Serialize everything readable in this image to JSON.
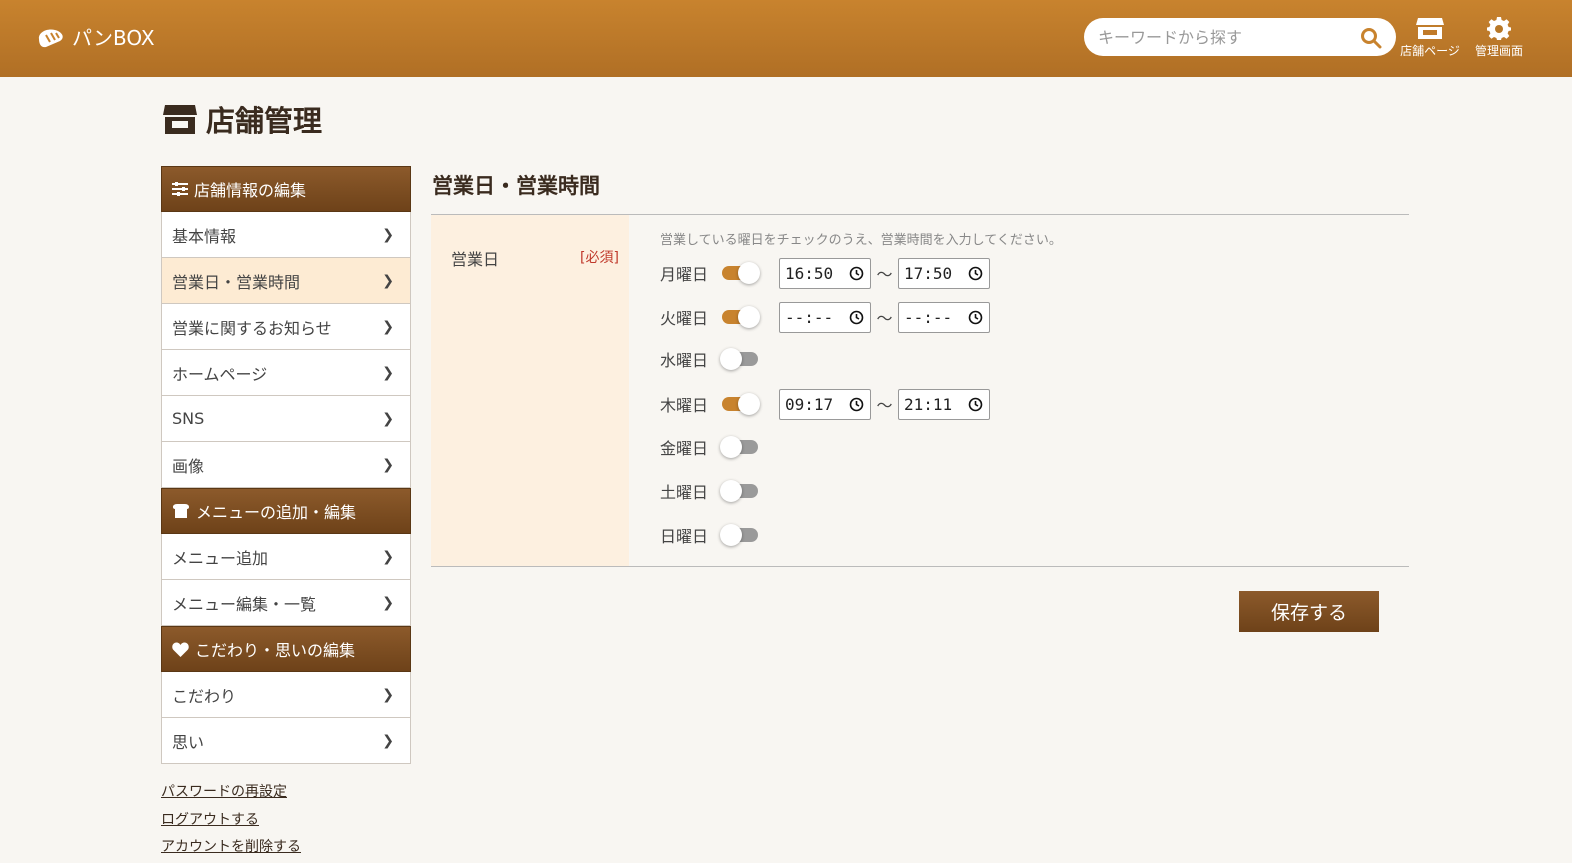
{
  "header": {
    "logo_text": "パンBOX",
    "search_placeholder": "キーワードから探す",
    "store_page_label": "店舗ページ",
    "admin_label": "管理画面"
  },
  "page_title": "店舗管理",
  "sidebar": {
    "sections": [
      {
        "title": "店舗情報の編集",
        "icon": "sliders-icon",
        "items": [
          {
            "label": "基本情報",
            "active": false
          },
          {
            "label": "営業日・営業時間",
            "active": true
          },
          {
            "label": "営業に関するお知らせ",
            "active": false
          },
          {
            "label": "ホームページ",
            "active": false
          },
          {
            "label": "SNS",
            "active": false
          },
          {
            "label": "画像",
            "active": false
          }
        ]
      },
      {
        "title": "メニューの追加・編集",
        "icon": "bread-icon",
        "items": [
          {
            "label": "メニュー追加",
            "active": false
          },
          {
            "label": "メニュー編集・一覧",
            "active": false
          }
        ]
      },
      {
        "title": "こだわり・思いの編集",
        "icon": "heart-icon",
        "items": [
          {
            "label": "こだわり",
            "active": false
          },
          {
            "label": "思い",
            "active": false
          }
        ]
      }
    ],
    "links": [
      "パスワードの再設定",
      "ログアウトする",
      "アカウントを削除する"
    ]
  },
  "main": {
    "section_title": "営業日・営業時間",
    "field_label": "営業日",
    "required_label": "[必須]",
    "hint": "営業している曜日をチェックのうえ、営業時間を入力してください。",
    "tilde": "〜",
    "days": [
      {
        "name": "月曜日",
        "on": true,
        "open": "16:50",
        "close": "17:50"
      },
      {
        "name": "火曜日",
        "on": true,
        "open": "--:--",
        "close": "--:--"
      },
      {
        "name": "水曜日",
        "on": false
      },
      {
        "name": "木曜日",
        "on": true,
        "open": "09:17",
        "close": "21:11"
      },
      {
        "name": "金曜日",
        "on": false
      },
      {
        "name": "土曜日",
        "on": false
      },
      {
        "name": "日曜日",
        "on": false
      }
    ],
    "save_label": "保存する"
  },
  "colors": {
    "header": "#c8832e",
    "accent_dark": "#6e4219",
    "active_bg": "#fdebd3",
    "label_bg": "#fdf0e0",
    "required": "#c0392b"
  }
}
